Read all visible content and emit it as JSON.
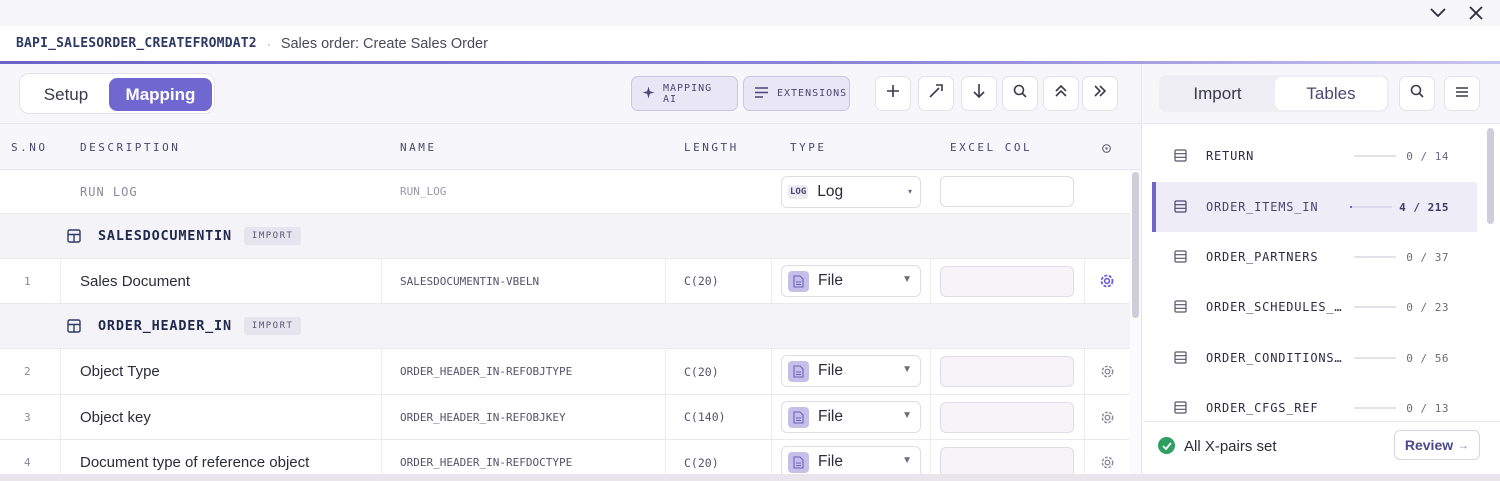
{
  "header": {
    "code": "BAPI_SALESORDER_CREATEFROMDAT2",
    "separator": "·",
    "subtitle": "Sales order: Create Sales Order"
  },
  "window": {
    "collapse_icon": "chevron-down-icon",
    "close_icon": "close-icon"
  },
  "toolbar": {
    "tabs": [
      {
        "label": "Setup",
        "active": false
      },
      {
        "label": "Mapping",
        "active": true
      }
    ],
    "mapping_ai_label": "MAPPING AI",
    "extensions_label": "EXTENSIONS",
    "icons": [
      "plus-icon",
      "magic-wand-icon",
      "arrow-down-icon",
      "search-icon",
      "collapse-up-icon",
      "double-chevron-right-icon"
    ]
  },
  "table": {
    "columns": {
      "sno": "S.NO",
      "description": "DESCRIPTION",
      "name": "NAME",
      "length": "LENGTH",
      "type": "TYPE",
      "excel_col": "EXCEL COL"
    },
    "run_log": {
      "description": "RUN LOG",
      "name": "RUN_LOG",
      "type_badge": "LOG",
      "type": "Log",
      "excel_col": ""
    },
    "groups": [
      {
        "name": "SALESDOCUMENTIN",
        "badge": "IMPORT",
        "rows": [
          {
            "sno": "1",
            "description": "Sales Document",
            "name": "SALESDOCUMENTIN-VBELN",
            "length": "C(20)",
            "type": "File",
            "excel_col": ""
          }
        ]
      },
      {
        "name": "ORDER_HEADER_IN",
        "badge": "IMPORT",
        "rows": [
          {
            "sno": "2",
            "description": "Object Type",
            "name": "ORDER_HEADER_IN-REFOBJTYPE",
            "length": "C(20)",
            "type": "File",
            "excel_col": ""
          },
          {
            "sno": "3",
            "description": "Object key",
            "name": "ORDER_HEADER_IN-REFOBJKEY",
            "length": "C(140)",
            "type": "File",
            "excel_col": ""
          },
          {
            "sno": "4",
            "description": "Document type of reference object",
            "name": "ORDER_HEADER_IN-REFDOCTYPE",
            "length": "C(20)",
            "type": "File",
            "excel_col": ""
          }
        ]
      }
    ]
  },
  "right_panel": {
    "tabs": [
      {
        "label": "Import",
        "active": false
      },
      {
        "label": "Tables",
        "active": true
      }
    ],
    "items": [
      {
        "name": "RETURN",
        "count": "0 / 14",
        "progress": 0,
        "active": false
      },
      {
        "name": "ORDER_ITEMS_IN",
        "count": "4 / 215",
        "progress": 0.019,
        "active": true
      },
      {
        "name": "ORDER_PARTNERS",
        "count": "0 / 37",
        "progress": 0,
        "active": false
      },
      {
        "name": "ORDER_SCHEDULES_…",
        "count": "0 / 23",
        "progress": 0,
        "active": false
      },
      {
        "name": "ORDER_CONDITIONS…",
        "count": "0 / 56",
        "progress": 0,
        "active": false
      },
      {
        "name": "ORDER_CFGS_REF",
        "count": "0 / 13",
        "progress": 0,
        "active": false
      }
    ],
    "status": "All X-pairs set",
    "review_label": "Review",
    "review_arrow": "→"
  },
  "colors": {
    "accent": "#7067d0",
    "success": "#2f9e63"
  }
}
